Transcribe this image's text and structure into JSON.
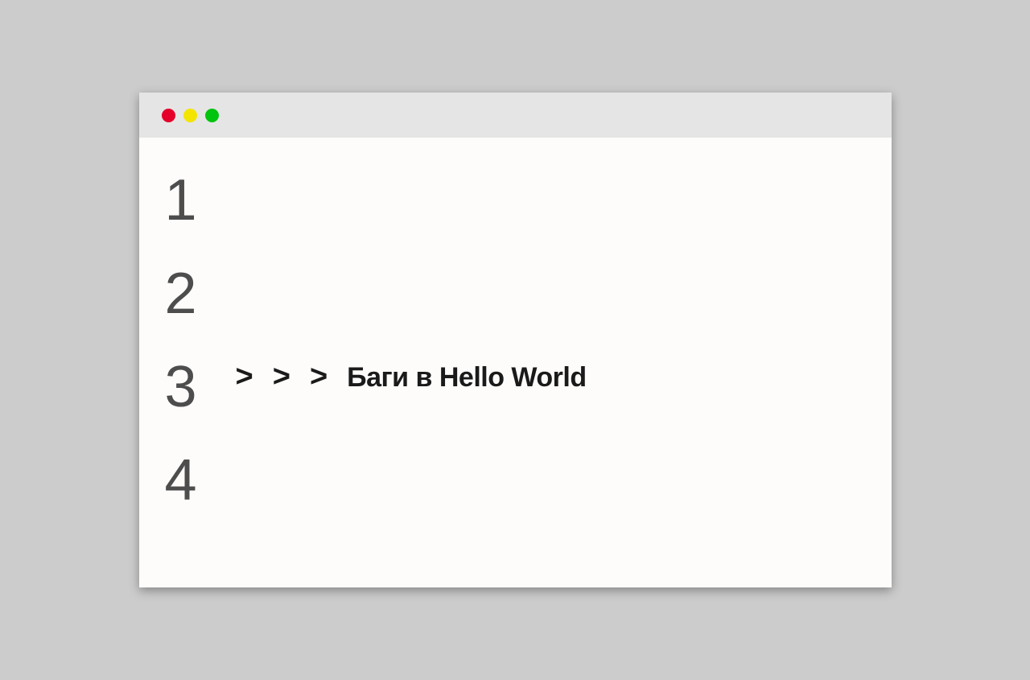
{
  "gutter": {
    "lines": [
      "1",
      "2",
      "3",
      "4"
    ]
  },
  "prompt": {
    "chevrons": [
      ">",
      ">",
      ">"
    ]
  },
  "content": {
    "text": "Баги в Hello World"
  }
}
